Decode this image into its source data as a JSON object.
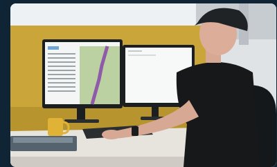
{
  "scene": {
    "description_tag": "",
    "accent_colors": {
      "wall_yellow": "#caa63a",
      "frame_navy": "#0f2536",
      "shirt_black": "#16181a",
      "mug_yellow": "#e0b235"
    },
    "monitor_left": {
      "icon": "map-dashboard-screen"
    },
    "monitor_right": {
      "icon": "blank-document-screen"
    }
  }
}
